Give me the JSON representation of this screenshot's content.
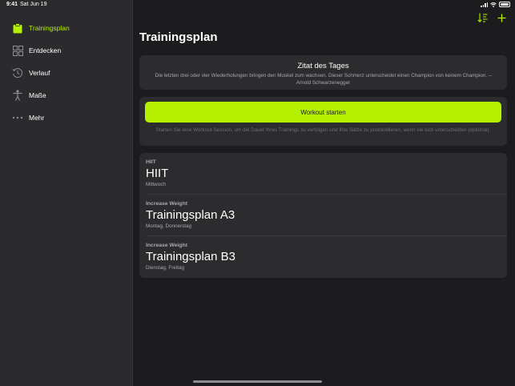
{
  "status_bar": {
    "time": "9:41",
    "date": "Sat Jun 19"
  },
  "sidebar": {
    "items": [
      {
        "label": "Trainingsplan",
        "icon": "clipboard-icon",
        "active": true
      },
      {
        "label": "Entdecken",
        "icon": "grid-icon",
        "active": false
      },
      {
        "label": "Verlauf",
        "icon": "history-clock-icon",
        "active": false
      },
      {
        "label": "Maße",
        "icon": "body-figure-icon",
        "active": false
      },
      {
        "label": "Mehr",
        "icon": "more-dots-icon",
        "active": false
      }
    ]
  },
  "toolbar": {
    "sort_icon": "sort-icon",
    "add_icon": "plus-icon"
  },
  "main": {
    "title": "Trainingsplan",
    "quote": {
      "title": "Zitat des Tages",
      "text": "Die letzten drei oder vier Wiederholungen bringen den Muskel zum wachsen. Dieser Schmerz unterscheidet einen Champion von keinem Champion. – Arnold Schwarzenegger"
    },
    "workout": {
      "button_label": "Workout starten",
      "hint": "Starten Sie eine Workout-Session, um die Dauer Ihres Trainings zu verfolgen und Ihre Sätze zu protokollieren, wenn sie sich unterscheiden (optional)."
    },
    "plans": [
      {
        "category": "HIIT",
        "name": "HIIT",
        "days": "Mittwoch"
      },
      {
        "category": "Increase Weight",
        "name": "Trainingsplan A3",
        "days": "Montag, Donnerstag"
      },
      {
        "category": "Increase Weight",
        "name": "Trainingsplan B3",
        "days": "Dienstag, Freitag"
      }
    ]
  },
  "colors": {
    "accent": "#b5f000",
    "background": "#1c1c1e",
    "sidebar": "#2b2b2e",
    "card": "#2c2c2e",
    "secondary_text": "#a8a8ad"
  }
}
